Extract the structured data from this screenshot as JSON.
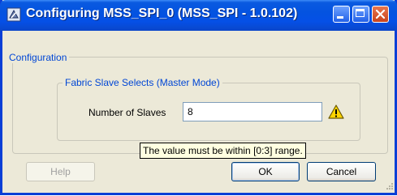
{
  "window": {
    "title": "Configuring MSS_SPI_0 (MSS_SPI - 1.0.102)",
    "icons": [
      "app-icon",
      "minimize-icon",
      "maximize-icon",
      "close-icon"
    ]
  },
  "configuration": {
    "legend": "Configuration",
    "fabric_group": {
      "legend": "Fabric Slave Selects (Master Mode)",
      "slaves_label": "Number of Slaves",
      "slaves_value": "8",
      "warning_icon": "warning-icon"
    }
  },
  "tooltip": {
    "text": "The value must be within [0:3] range."
  },
  "buttons": {
    "help": "Help",
    "ok": "OK",
    "cancel": "Cancel"
  },
  "colors": {
    "title_bar": "#0453e0",
    "legend_text": "#0046d5",
    "tooltip_bg": "#ffffe1",
    "dialog_bg": "#ece9d8",
    "warning": "#ffd400"
  }
}
